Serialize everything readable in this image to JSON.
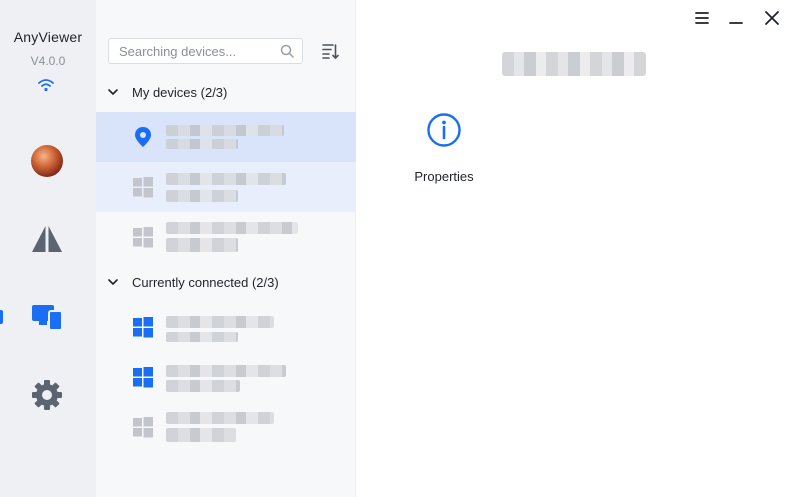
{
  "app": {
    "name": "AnyViewer",
    "version": "V4.0.0"
  },
  "rail": {
    "items": [
      {
        "name": "profile",
        "icon": "avatar"
      },
      {
        "name": "connect",
        "icon": "connect-icon"
      },
      {
        "name": "devices",
        "icon": "devices-icon",
        "active": true
      },
      {
        "name": "settings",
        "icon": "gear-icon"
      }
    ]
  },
  "panel": {
    "search": {
      "placeholder": "Searching devices..."
    },
    "groups": [
      {
        "label": "My devices (2/3)",
        "expanded": true
      },
      {
        "label": "Currently connected (2/3)",
        "expanded": true
      }
    ],
    "rows": [
      {
        "icon": "location-pin-icon",
        "state": "selected"
      },
      {
        "icon": "windows-icon",
        "state": "hover"
      },
      {
        "icon": "windows-icon",
        "state": "normal"
      },
      {
        "icon": "windows-icon",
        "state": "online"
      },
      {
        "icon": "windows-icon",
        "state": "online"
      },
      {
        "icon": "windows-icon",
        "state": "offline"
      }
    ]
  },
  "main": {
    "actions": [
      {
        "label": "Properties",
        "icon": "info-icon"
      }
    ]
  },
  "colors": {
    "accent": "#1a6ef4",
    "rail_bg": "#eef0f4",
    "panel_bg": "#f7f8fa",
    "selected_row": "#d9e4fb",
    "offline_icon": "#c2c6cc"
  }
}
